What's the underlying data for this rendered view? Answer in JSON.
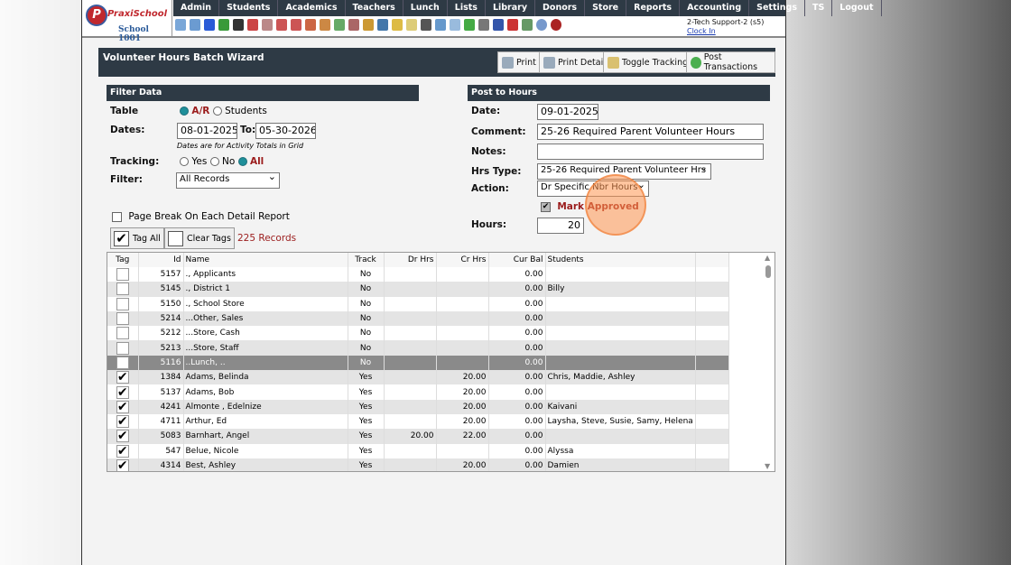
{
  "header": {
    "logo_text": "PraxiSchool",
    "school": "School 1001",
    "user": "2-Tech Support-2 (s5)",
    "clock_in": "Clock In",
    "menu": [
      "Admin",
      "Students",
      "Academics",
      "Teachers",
      "Lunch",
      "Lists",
      "Library",
      "Donors",
      "Store",
      "Reports",
      "Accounting",
      "Settings",
      "TS",
      "Logout"
    ]
  },
  "toolbar_icons": [
    "search-icon",
    "calendar-grid-icon",
    "email-icon",
    "chat-icon",
    "phone-icon",
    "speaker-icon",
    "report-icon",
    "calendar-icon",
    "megaphone-icon",
    "add-user-icon",
    "user-icon",
    "money-icon",
    "family-icon",
    "lunch-icon",
    "book-icon",
    "bell-icon",
    "notes-icon",
    "staff-icon",
    "clock-icon",
    "calculator-icon",
    "card-icon",
    "printer-icon",
    "ap-icon",
    "pdf-icon",
    "cash-register-icon",
    "help-icon",
    "power-icon"
  ],
  "wizard": {
    "title": "Volunteer Hours Batch Wizard",
    "buttons": {
      "print": "Print",
      "print_detail": "Print Detail",
      "toggle_tracking": "Toggle Tracking",
      "post": "Post Transactions"
    }
  },
  "filter": {
    "title": "Filter Data",
    "table_label": "Table",
    "table_ar": "A/R",
    "table_students": "Students",
    "dates_label": "Dates:",
    "date_from": "08-01-2025",
    "to_label": "To:",
    "date_to": "05-30-2026",
    "dates_note": "Dates are for Activity Totals in Grid",
    "tracking_label": "Tracking:",
    "yes": "Yes",
    "no": "No",
    "all": "All",
    "filter_label": "Filter:",
    "filter_value": "All Records",
    "page_break": "Page Break On Each Detail Report",
    "tag_all": "Tag All",
    "clear_tags": "Clear Tags",
    "records": "225 Records"
  },
  "post": {
    "title": "Post to Hours",
    "date_label": "Date:",
    "date": "09-01-2025",
    "comment_label": "Comment:",
    "comment": "25-26 Required Parent Volunteer Hours",
    "notes_label": "Notes:",
    "notes": "",
    "hrs_type_label": "Hrs Type:",
    "hrs_type": "25-26 Required Parent Volunteer Hrs",
    "action_label": "Action:",
    "action": "Dr Specific Nbr Hours",
    "mark_approved": "Mark Approved",
    "hours_label": "Hours:",
    "hours": "20"
  },
  "grid": {
    "columns": [
      "Tag",
      "Id",
      "Name",
      "Track",
      "Dr Hrs",
      "Cr Hrs",
      "Cur Bal",
      "Students"
    ],
    "rows": [
      {
        "tag": false,
        "id": "5157",
        "name": "., Applicants",
        "track": "No",
        "dr": "",
        "cr": "",
        "bal": "0.00",
        "students": ""
      },
      {
        "tag": false,
        "id": "5145",
        "name": "., District 1",
        "track": "No",
        "dr": "",
        "cr": "",
        "bal": "0.00",
        "students": "Billy"
      },
      {
        "tag": false,
        "id": "5150",
        "name": "., School Store",
        "track": "No",
        "dr": "",
        "cr": "",
        "bal": "0.00",
        "students": ""
      },
      {
        "tag": false,
        "id": "5214",
        "name": "...Other, Sales",
        "track": "No",
        "dr": "",
        "cr": "",
        "bal": "0.00",
        "students": ""
      },
      {
        "tag": false,
        "id": "5212",
        "name": "...Store, Cash",
        "track": "No",
        "dr": "",
        "cr": "",
        "bal": "0.00",
        "students": ""
      },
      {
        "tag": false,
        "id": "5213",
        "name": "...Store, Staff",
        "track": "No",
        "dr": "",
        "cr": "",
        "bal": "0.00",
        "students": ""
      },
      {
        "tag": false,
        "id": "5116",
        "name": "..Lunch, ..",
        "track": "No",
        "dr": "",
        "cr": "",
        "bal": "0.00",
        "students": "",
        "selected": true
      },
      {
        "tag": true,
        "id": "1384",
        "name": "Adams, Belinda",
        "track": "Yes",
        "dr": "",
        "cr": "20.00",
        "bal": "0.00",
        "students": "Chris, Maddie, Ashley"
      },
      {
        "tag": true,
        "id": "5137",
        "name": "Adams, Bob",
        "track": "Yes",
        "dr": "",
        "cr": "20.00",
        "bal": "0.00",
        "students": ""
      },
      {
        "tag": true,
        "id": "4241",
        "name": "Almonte , Edelnize",
        "track": "Yes",
        "dr": "",
        "cr": "20.00",
        "bal": "0.00",
        "students": "Kaivani"
      },
      {
        "tag": true,
        "id": "4711",
        "name": "Arthur, Ed",
        "track": "Yes",
        "dr": "",
        "cr": "20.00",
        "bal": "0.00",
        "students": "Laysha, Steve, Susie, Samy, Helena"
      },
      {
        "tag": true,
        "id": "5083",
        "name": "Barnhart, Angel",
        "track": "Yes",
        "dr": "20.00",
        "cr": "22.00",
        "bal": "0.00",
        "students": ""
      },
      {
        "tag": true,
        "id": "547",
        "name": "Belue, Nicole",
        "track": "Yes",
        "dr": "",
        "cr": "",
        "bal": "0.00",
        "students": "Alyssa"
      },
      {
        "tag": true,
        "id": "4314",
        "name": "Best, Ashley",
        "track": "Yes",
        "dr": "",
        "cr": "20.00",
        "bal": "0.00",
        "students": "Damien"
      }
    ]
  }
}
